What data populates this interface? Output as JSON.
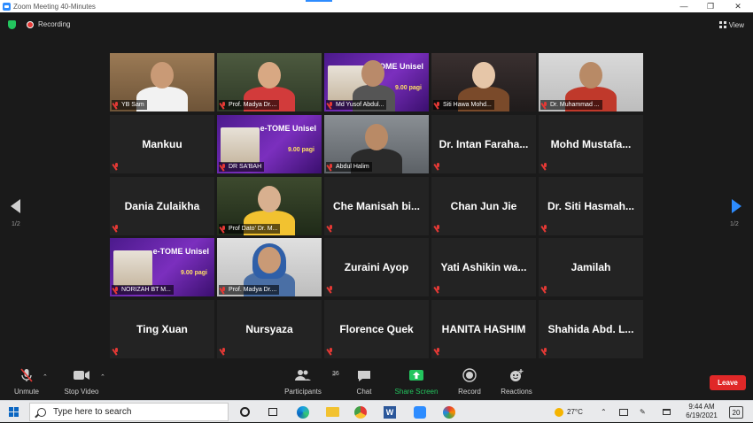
{
  "window": {
    "title": "Zoom Meeting 40-Minutes",
    "controls": [
      "—",
      "❐",
      "✕"
    ]
  },
  "topbar": {
    "recording_label": "Recording",
    "view_label": "View"
  },
  "grid": {
    "tiles": [
      {
        "label": "YB Sam",
        "kind": "video"
      },
      {
        "label": "Prof. Madya Dr....",
        "kind": "video"
      },
      {
        "label": "Md Yusof Abdul...",
        "kind": "poster"
      },
      {
        "label": "Siti Hawa Mohd...",
        "kind": "video"
      },
      {
        "label": "Dr. Muhammad ...",
        "kind": "video"
      },
      {
        "label": "Mankuu",
        "kind": "name"
      },
      {
        "label": "DR SA'BAH",
        "kind": "poster"
      },
      {
        "label": "Abdul Halim",
        "kind": "video",
        "active": true
      },
      {
        "label": "Dr. Intan Faraha...",
        "kind": "name"
      },
      {
        "label": "Mohd Mustafa...",
        "kind": "name"
      },
      {
        "label": "Dania Zulaikha",
        "kind": "name"
      },
      {
        "label": "Prof Dato' Dr. M...",
        "kind": "video"
      },
      {
        "label": "Che Manisah bi...",
        "kind": "name"
      },
      {
        "label": "Chan Jun Jie",
        "kind": "name"
      },
      {
        "label": "Dr. Siti Hasmah...",
        "kind": "name"
      },
      {
        "label": "NORIZAH BT M...",
        "kind": "poster"
      },
      {
        "label": "Prof. Madya Dr....",
        "kind": "video"
      },
      {
        "label": "Zuraini Ayop",
        "kind": "name"
      },
      {
        "label": "Yati Ashikin wa...",
        "kind": "name"
      },
      {
        "label": "Jamilah",
        "kind": "name"
      },
      {
        "label": "Ting Xuan",
        "kind": "name"
      },
      {
        "label": "Nursyaza",
        "kind": "name"
      },
      {
        "label": "Florence Quek",
        "kind": "name"
      },
      {
        "label": "HANITA HASHIM",
        "kind": "name"
      },
      {
        "label": "Shahida Abd. L...",
        "kind": "name"
      }
    ],
    "poster_title": "e-TOME Unisel",
    "poster_time": "9.00 pagi"
  },
  "pager": {
    "left": "1/2",
    "right": "1/2"
  },
  "toolbar": {
    "unmute": "Unmute",
    "stop_video": "Stop Video",
    "participants": "Participants",
    "participants_count": "36",
    "chat": "Chat",
    "share_screen": "Share Screen",
    "record": "Record",
    "reactions": "Reactions",
    "leave": "Leave",
    "share_color": "#23c55e",
    "leave_color": "#e02828"
  },
  "taskbar": {
    "search_placeholder": "Type here to search",
    "temperature": "27°C",
    "time": "9:44 AM",
    "date": "6/19/2021",
    "notification_count": "20"
  }
}
